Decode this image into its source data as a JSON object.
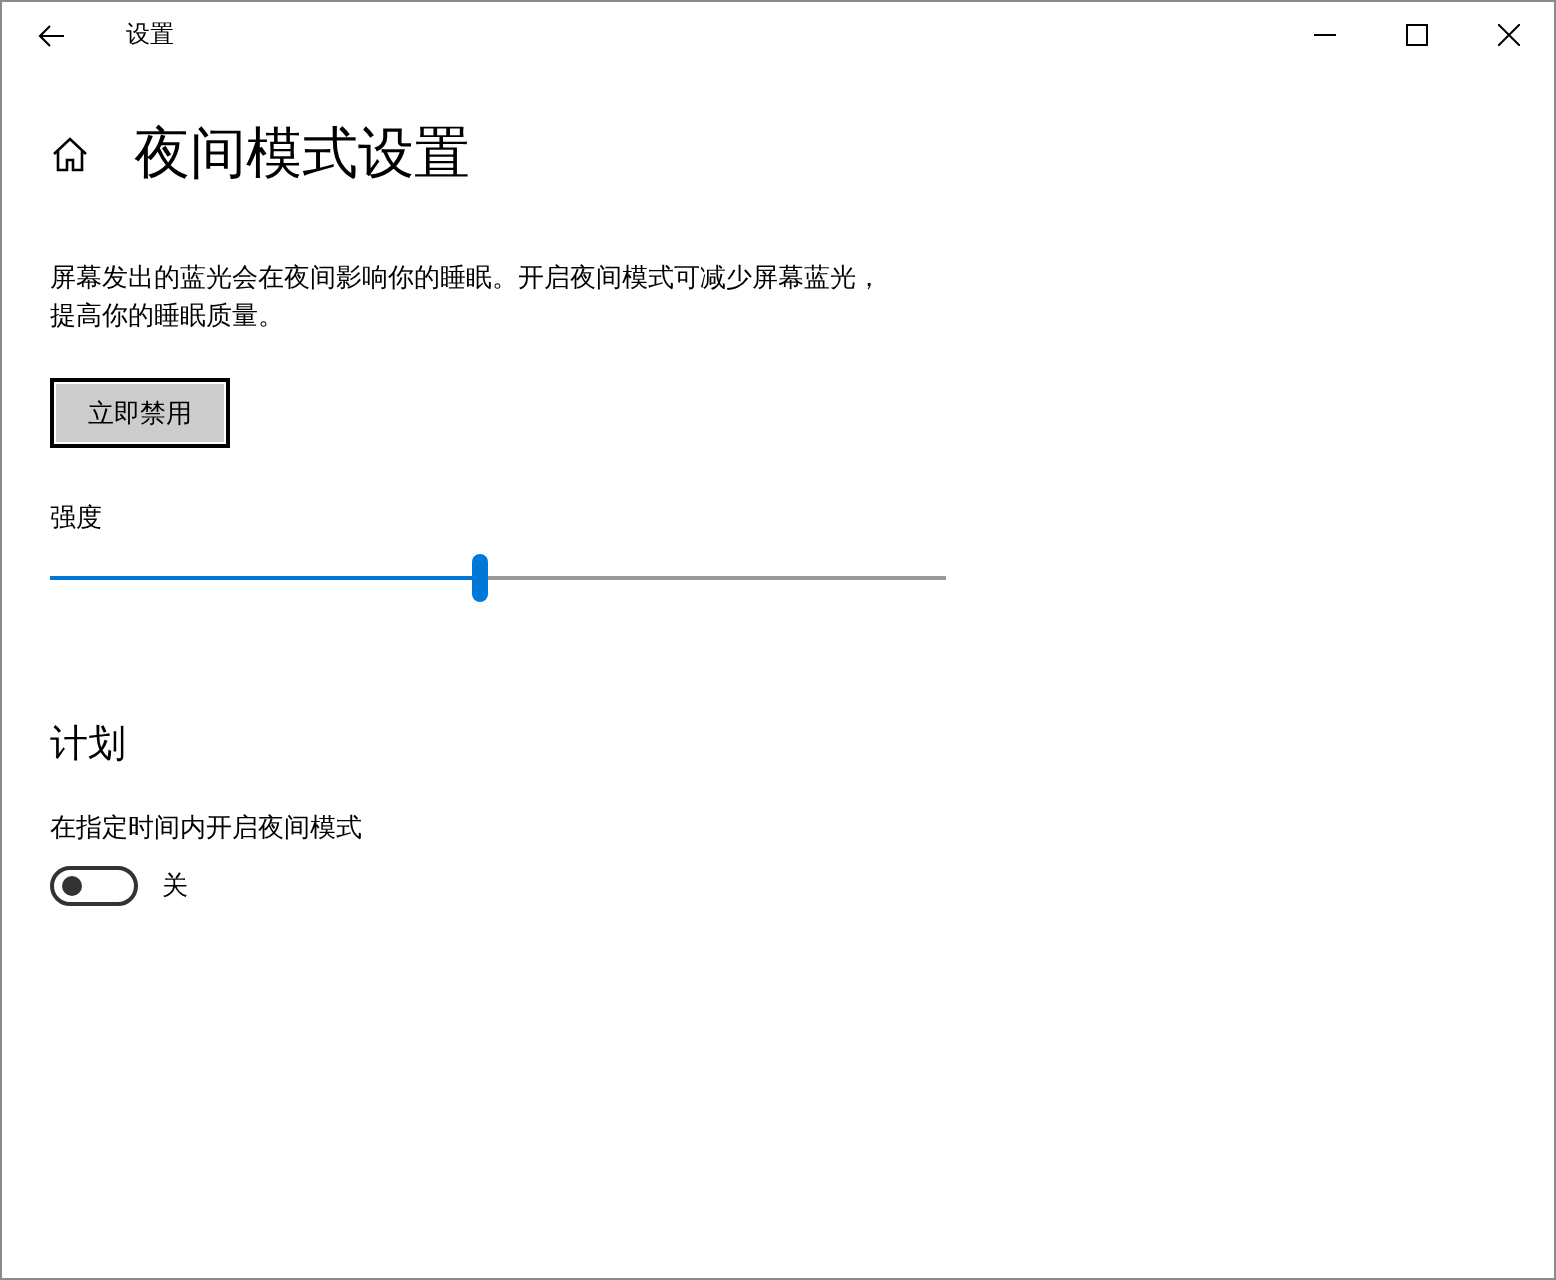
{
  "window": {
    "title": "设置"
  },
  "page": {
    "title": "夜间模式设置",
    "description": "屏幕发出的蓝光会在夜间影响你的睡眠。开启夜间模式可减少屏幕蓝光，提高你的睡眠质量。",
    "button": "立即禁用"
  },
  "strength": {
    "label": "强度",
    "level": 0.48
  },
  "schedule": {
    "heading": "计划",
    "label": "在指定时间内开启夜间模式",
    "toggle": {
      "on": false,
      "state_label": "关"
    }
  }
}
